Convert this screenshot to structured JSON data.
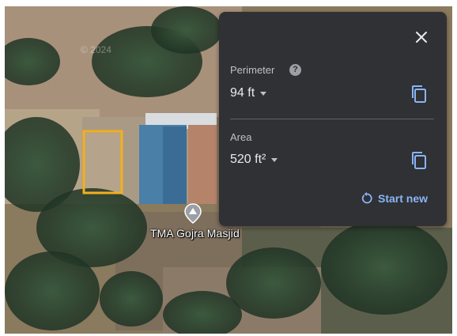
{
  "map": {
    "place_label": "TMA Gojra Masjid",
    "watermark": "© 2024",
    "selection_color": "#f2b01e"
  },
  "panel": {
    "close_icon": "close-icon",
    "perimeter": {
      "label": "Perimeter",
      "help": "?",
      "value": "94 ft",
      "copy_icon": "copy-icon"
    },
    "area": {
      "label": "Area",
      "value": "520 ft²",
      "copy_icon": "copy-icon"
    },
    "start_new": {
      "label": "Start new",
      "icon": "refresh-icon",
      "color": "#8ab4f8"
    }
  }
}
